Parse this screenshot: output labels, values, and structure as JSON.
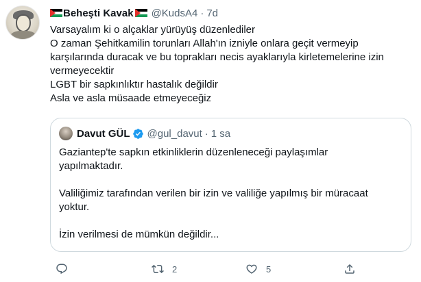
{
  "tweet": {
    "author_name": "Beheşti Kavak",
    "handle": "@KudsA4",
    "separator": "·",
    "time": "7d",
    "lines": [
      "Varsayalım ki o alçaklar yürüyüş düzenlediler",
      "O zaman Şehitkamilin torunları Allah'ın izniyle onlara geçit vermeyip",
      "karşılarında duracak ve bu toprakları necis ayaklarıyla kirletemelerine izin",
      "vermeyecektir",
      "LGBT bir sapkınlıktır hastalık değildir",
      "Asla ve asla müsaade etmeyeceğiz"
    ]
  },
  "quote": {
    "author_name": "Davut GÜL",
    "handle": "@gul_davut",
    "separator": "·",
    "time": "1 sa",
    "lines": [
      "Gaziantep'te sapkın etkinliklerin düzenleneceği  paylaşımlar",
      "yapılmaktadır.",
      "",
      "Valiliğimiz tarafından verilen bir izin ve  valiliğe yapılmış bir müracaat",
      "yoktur.",
      "",
      "İzin verilmesi de mümkün değildir..."
    ]
  },
  "actions": {
    "reply": {
      "icon": "reply-icon",
      "count": ""
    },
    "retweet": {
      "icon": "retweet-icon",
      "count": "2"
    },
    "like": {
      "icon": "like-icon",
      "count": "5"
    },
    "share": {
      "icon": "share-icon",
      "count": ""
    }
  },
  "colors": {
    "text_primary": "#0f1419",
    "text_secondary": "#536471",
    "border": "#cfd9de",
    "verified": "#1d9bf0",
    "flag_black": "#000000",
    "flag_white": "#ffffff",
    "flag_green": "#149954",
    "flag_red": "#e4312b"
  }
}
